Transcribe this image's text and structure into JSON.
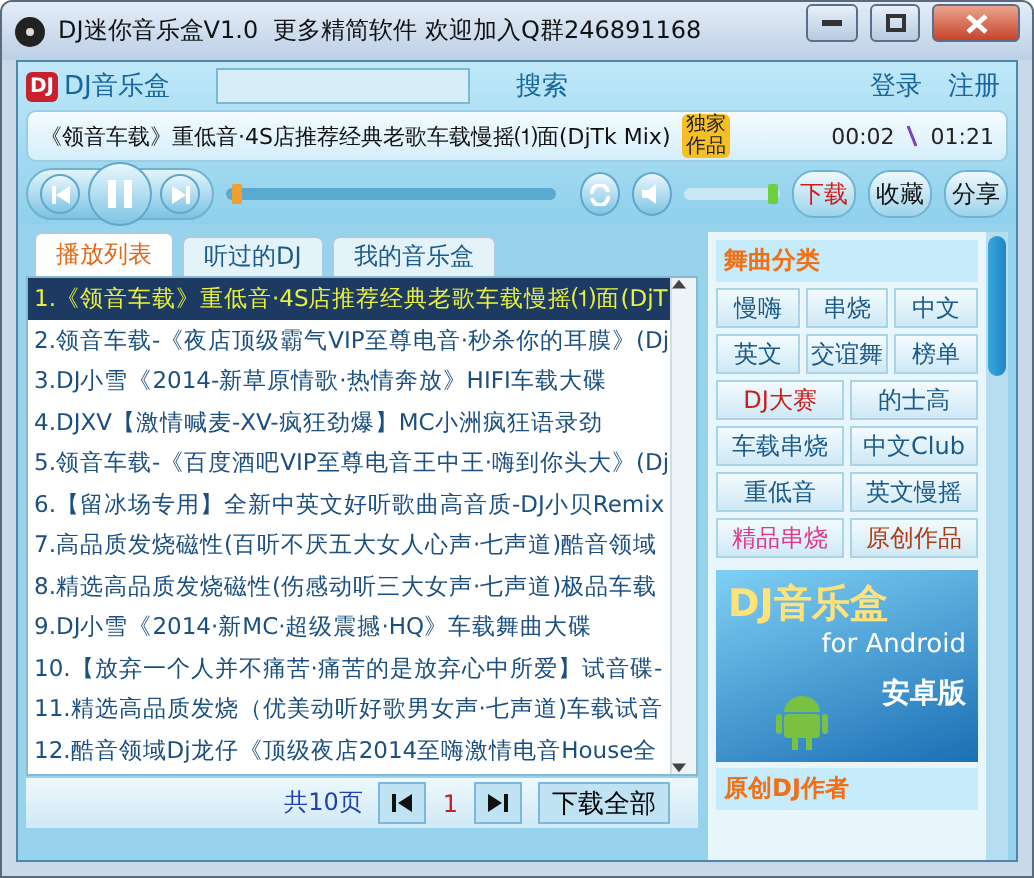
{
  "window": {
    "title": "DJ迷你音乐盒V1.0  更多精简软件 欢迎加入Q群246891168"
  },
  "header": {
    "brand": "DJ音乐盒",
    "logo": "DJ",
    "search_button": "搜索",
    "login": "登录",
    "register": "注册"
  },
  "now_playing": {
    "title": "《领音车载》重低音·4S店推荐经典老歌车载慢摇⑴面(DjTk Mix)",
    "badge": "独家作品",
    "elapsed": "00:02",
    "total": "01:21"
  },
  "player": {
    "playing": true,
    "progress": {
      "level": 0.02
    },
    "volume": {
      "level": 0.97
    },
    "actions": [
      {
        "label": "下载",
        "kind": "download"
      },
      {
        "label": "收藏",
        "kind": "normal"
      },
      {
        "label": "分享",
        "kind": "normal"
      }
    ]
  },
  "tabs": [
    {
      "label": "播放列表",
      "selected": true
    },
    {
      "label": "听过的DJ",
      "selected": false
    },
    {
      "label": "我的音乐盒",
      "selected": false
    }
  ],
  "playlist": [
    {
      "title": "1.《领音车载》重低音·4S店推荐经典老歌车载慢摇⑴面(DjT",
      "selected": true
    },
    {
      "title": "2.领音车载-《夜店顶级霸气VIP至尊电音·秒杀你的耳膜》(Dj",
      "selected": false
    },
    {
      "title": "3.DJ小雪《2014-新草原情歌·热情奔放》HIFI车载大碟",
      "selected": false
    },
    {
      "title": "4.DJXV【激情喊麦-XV-疯狂劲爆】MC小洲疯狂语录劲",
      "selected": false
    },
    {
      "title": "5.领音车载-《百度酒吧VIP至尊电音王中王·嗨到你头大》(Dj",
      "selected": false
    },
    {
      "title": "6.【留冰场专用】全新中英文好听歌曲高音质-DJ小贝Remix",
      "selected": false
    },
    {
      "title": "7.高品质发烧磁性(百听不厌五大女人心声·七声道)酷音领域",
      "selected": false
    },
    {
      "title": "8.精选高品质发烧磁性(伤感动听三大女声·七声道)极品车载",
      "selected": false
    },
    {
      "title": "9.DJ小雪《2014·新MC·超级震撼·HQ》车载舞曲大碟",
      "selected": false
    },
    {
      "title": "10.【放弃一个人并不痛苦·痛苦的是放弃心中所爱】试音碟-",
      "selected": false
    },
    {
      "title": "11.精选高品质发烧（优美动听好歌男女声·七声道)车载试音",
      "selected": false
    },
    {
      "title": "12.酷音领域Dj龙仔《顶级夜店2014至嗨激情电音House全",
      "selected": false
    }
  ],
  "pager": {
    "total": "共10页",
    "page": "1",
    "download_all": "下载全部"
  },
  "categories": {
    "title": "舞曲分类",
    "items": [
      {
        "label": "慢嗨",
        "color": "#1a5a8a"
      },
      {
        "label": "串烧",
        "color": "#1a5a8a"
      },
      {
        "label": "中文",
        "color": "#1a5a8a"
      },
      {
        "label": "英文",
        "color": "#1a5a8a"
      },
      {
        "label": "交谊舞",
        "color": "#1a5a8a"
      },
      {
        "label": "榜单",
        "color": "#1a5a8a"
      },
      {
        "label": "DJ大赛",
        "color": "#c8201c"
      },
      {
        "label": "的士高",
        "color": "#1a5a8a"
      },
      {
        "label": "车载串烧",
        "color": "#1a5a8a"
      },
      {
        "label": "中文Club",
        "color": "#1a5a8a"
      },
      {
        "label": "重低音",
        "color": "#1a5a8a"
      },
      {
        "label": "英文慢摇",
        "color": "#1a5a8a"
      },
      {
        "label": "精品串烧",
        "color": "#e0368a"
      },
      {
        "label": "原创作品",
        "color": "#b03a10"
      }
    ]
  },
  "banner": {
    "title": "DJ音乐盒",
    "subtitle": "for Android",
    "label": "安卓版"
  },
  "section_2": {
    "title": "原创DJ作者"
  }
}
